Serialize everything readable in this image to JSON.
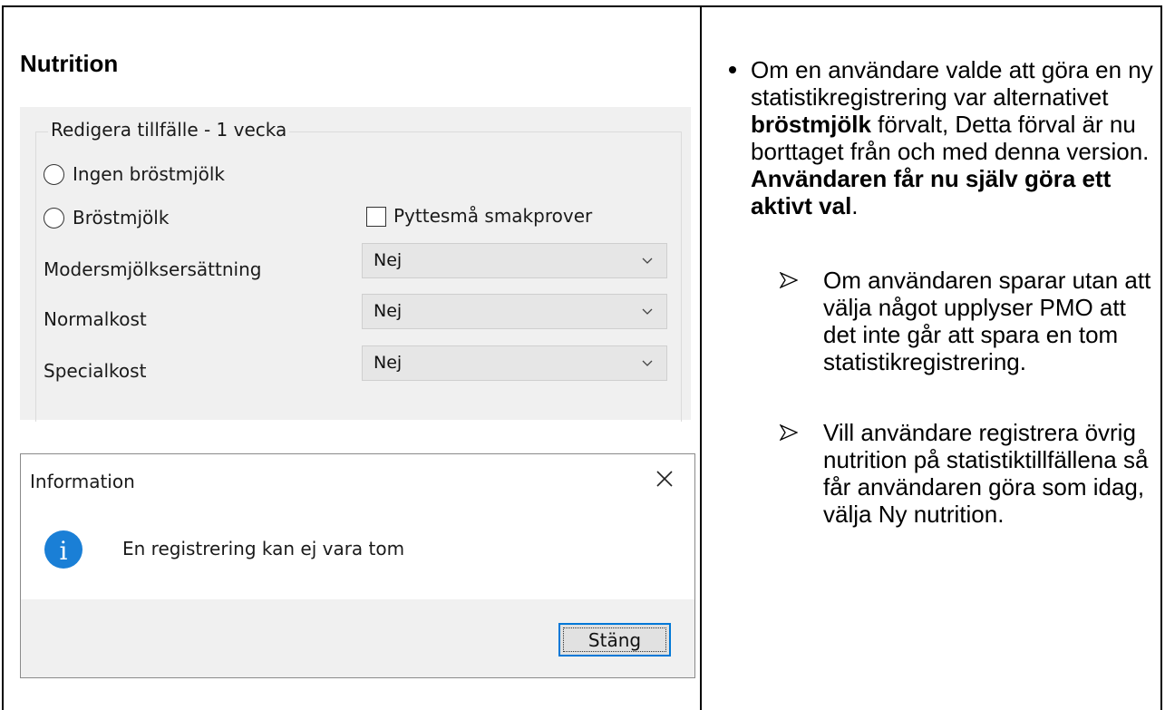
{
  "section_title": "Nutrition",
  "form": {
    "group_title": "Redigera tillfälle - 1 vecka",
    "radio_no_breastmilk": "Ingen bröstmjölk",
    "radio_breastmilk": "Bröstmjölk",
    "checkbox_tiny_tastes": "Pyttesmå smakprover",
    "rows": [
      {
        "label": "Modersmjölksersättning",
        "value": "Nej"
      },
      {
        "label": "Normalkost",
        "value": "Nej"
      },
      {
        "label": "Specialkost",
        "value": "Nej"
      }
    ]
  },
  "dialog": {
    "title": "Information",
    "message": "En registrering kan ej vara tom",
    "button": "Stäng",
    "icon": "info-icon"
  },
  "notes": {
    "bullet": {
      "part1": "Om en användare valde att göra en ny statistikregistrering var alternativet ",
      "bold1": "bröstmjölk",
      "part2": " förvalt, Detta förval är nu borttaget från och med denna version. ",
      "bold2": "Användaren får nu själv göra ett aktivt val",
      "part3": "."
    },
    "sub_items": [
      "Om användaren sparar utan att välja något upplyser PMO att det inte går att spara en tom statistikregistrering.",
      "Vill användare registrera övrig nutrition på statistiktillfällena så får användaren göra som idag, välja Ny nutrition."
    ]
  }
}
